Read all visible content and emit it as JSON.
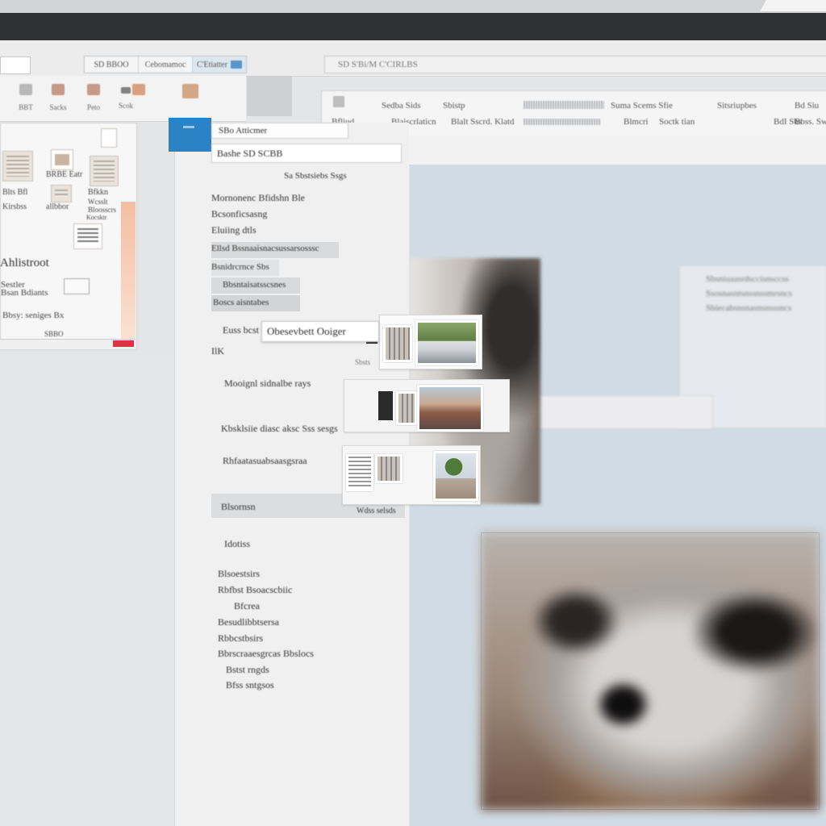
{
  "toolbar": {
    "tabs": [
      "SD BBOO",
      "Cebomamoc",
      "C'Etiatter"
    ],
    "address": "SD  S'Bi/M  C'CIRLBS"
  },
  "ribbon_left": {
    "items": [
      "BBT",
      "Sacks",
      "Peto",
      "Scok",
      ""
    ]
  },
  "ribbon_right": {
    "row1": [
      "Sedba Sids",
      "Sbistp",
      "Suma Scems Sfie",
      "Sitsriupbes",
      "Bd Siu"
    ],
    "row2": [
      "Bfliud",
      "Blaiscrlaticn",
      "Blalt Sscrd. Klatd",
      "Blmcri",
      "Soctk tian",
      "BdI Sbs",
      "Bbss. Sw"
    ]
  },
  "left_dialog": {
    "labels": [
      "BRBE Eatr",
      "Blts Bfl",
      "Bfkkn",
      "Wcsslt Bloosscrs",
      "allbbor",
      "Kirsbss",
      "Kocsktr"
    ],
    "title": "Ahlistroot",
    "lines": [
      "Sestler",
      "Bsan Bdiants",
      "Bbsy: seniges Bx",
      "SBBO"
    ]
  },
  "center_panel": {
    "header": "SBo Atticmer",
    "field": "Bashe SD SCBB",
    "list": [
      "Sa Sbstsiebs Ssgs",
      "Mornonenc Bfidshn Ble",
      "Bcsonficsasng",
      "Eluiing dtls",
      "Ellsd Bssnaaisnacsussarsosssc",
      "Bsnidrcrnce Sbs",
      "Bbsntaisatsscsnes",
      "Boscs aisntabes",
      "Euss bcst",
      "IlK",
      "Mooignl sidnalbe rays",
      "Kbsklsiie diasc aksc Sss sesgs",
      "Rhfaatasuabsaasgsraa",
      "Blsornsn",
      "Idotiss",
      "Blsoestsirs",
      "Rbfbst   Bsoacscbiic",
      "Bfcrea",
      "Besudlibbtsersa",
      "Rbbcstbsirs",
      "Bbrscraaesgrcas Bbslocs",
      "Bstst rngds",
      "Bfss sntgsos"
    ],
    "popup": "Obesevbett Ooiger",
    "side_label": "Wdss selsds",
    "stage_label": "Sbsts"
  },
  "content": {
    "lines": [
      "Sbsniuaasrdsccisnsccss",
      "Ssosnasntsnssnssmrsncs",
      "Sbiecabsnsnasnsnsssncs"
    ]
  }
}
